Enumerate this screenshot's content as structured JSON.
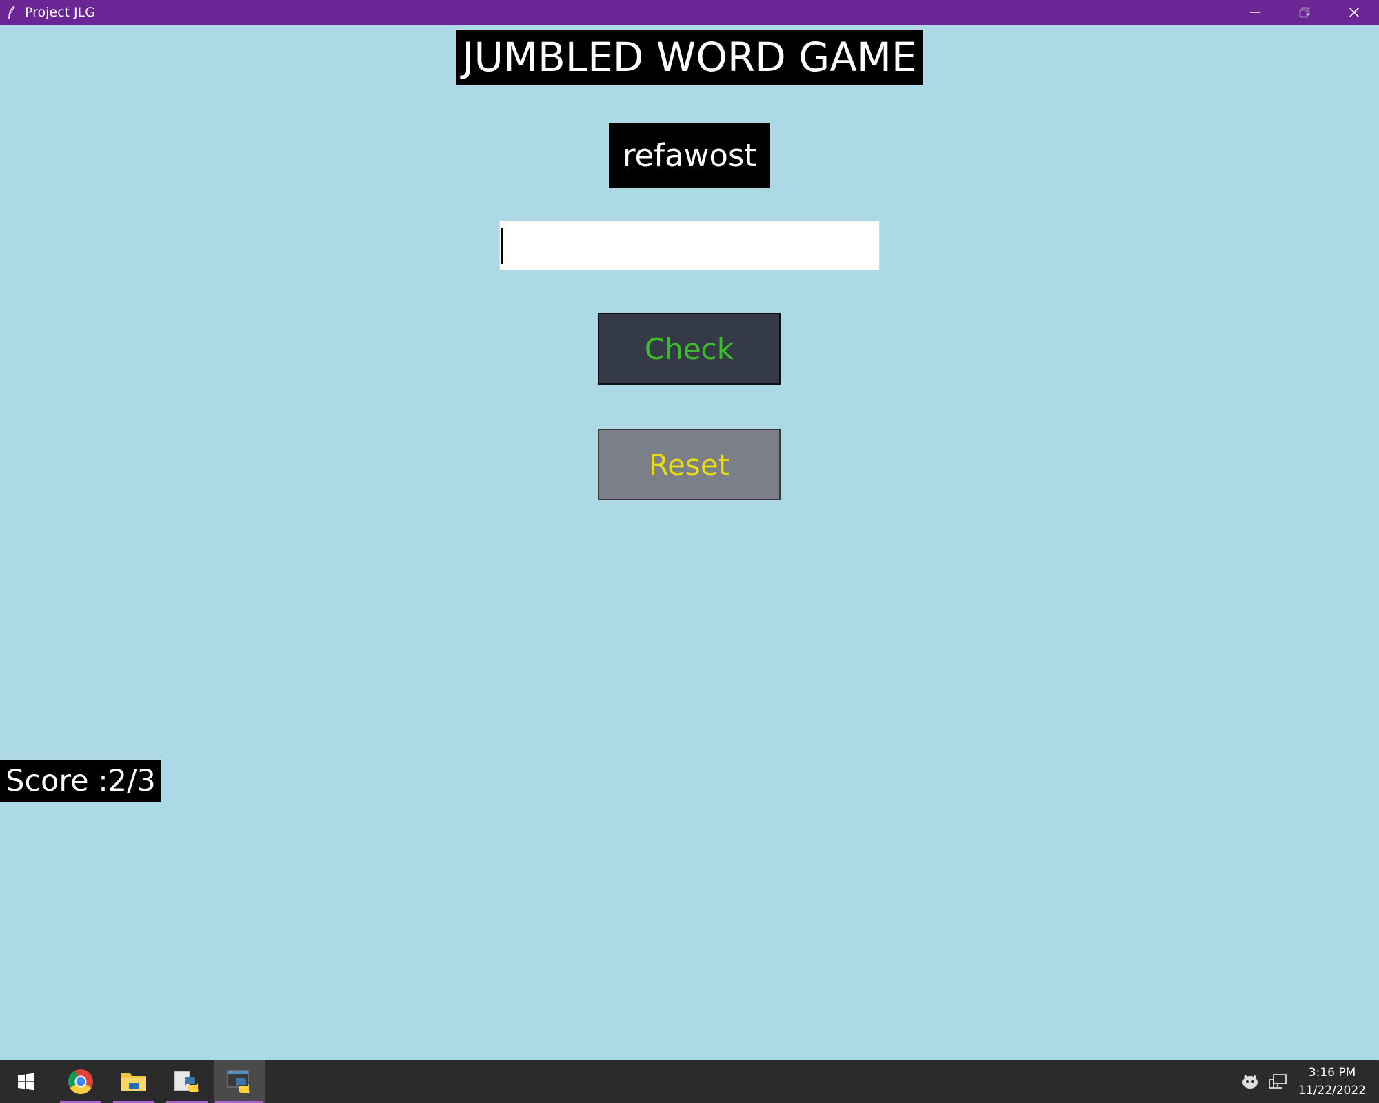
{
  "window": {
    "title": "Project JLG",
    "title_bar_color": "#6c2594",
    "background_color": "#add8e6",
    "controls": [
      "minimize-icon",
      "restore-icon",
      "close-icon"
    ]
  },
  "game": {
    "heading": "JUMBLED WORD GAME",
    "jumbled_word": "refawost",
    "answer_value": "",
    "check_label": "Check",
    "reset_label": "Reset",
    "score_label": "Score :2/3",
    "check_text_color": "#3dbd2a",
    "reset_text_color": "#e9dc12"
  },
  "taskbar": {
    "items": [
      {
        "name": "start-icon"
      },
      {
        "name": "chrome-icon"
      },
      {
        "name": "file-explorer-icon"
      },
      {
        "name": "python-idle-icon"
      },
      {
        "name": "python-app-icon"
      }
    ],
    "tray": [
      "security-icon",
      "network-icon"
    ],
    "time": "3:16 PM",
    "date": "11/22/2022"
  }
}
